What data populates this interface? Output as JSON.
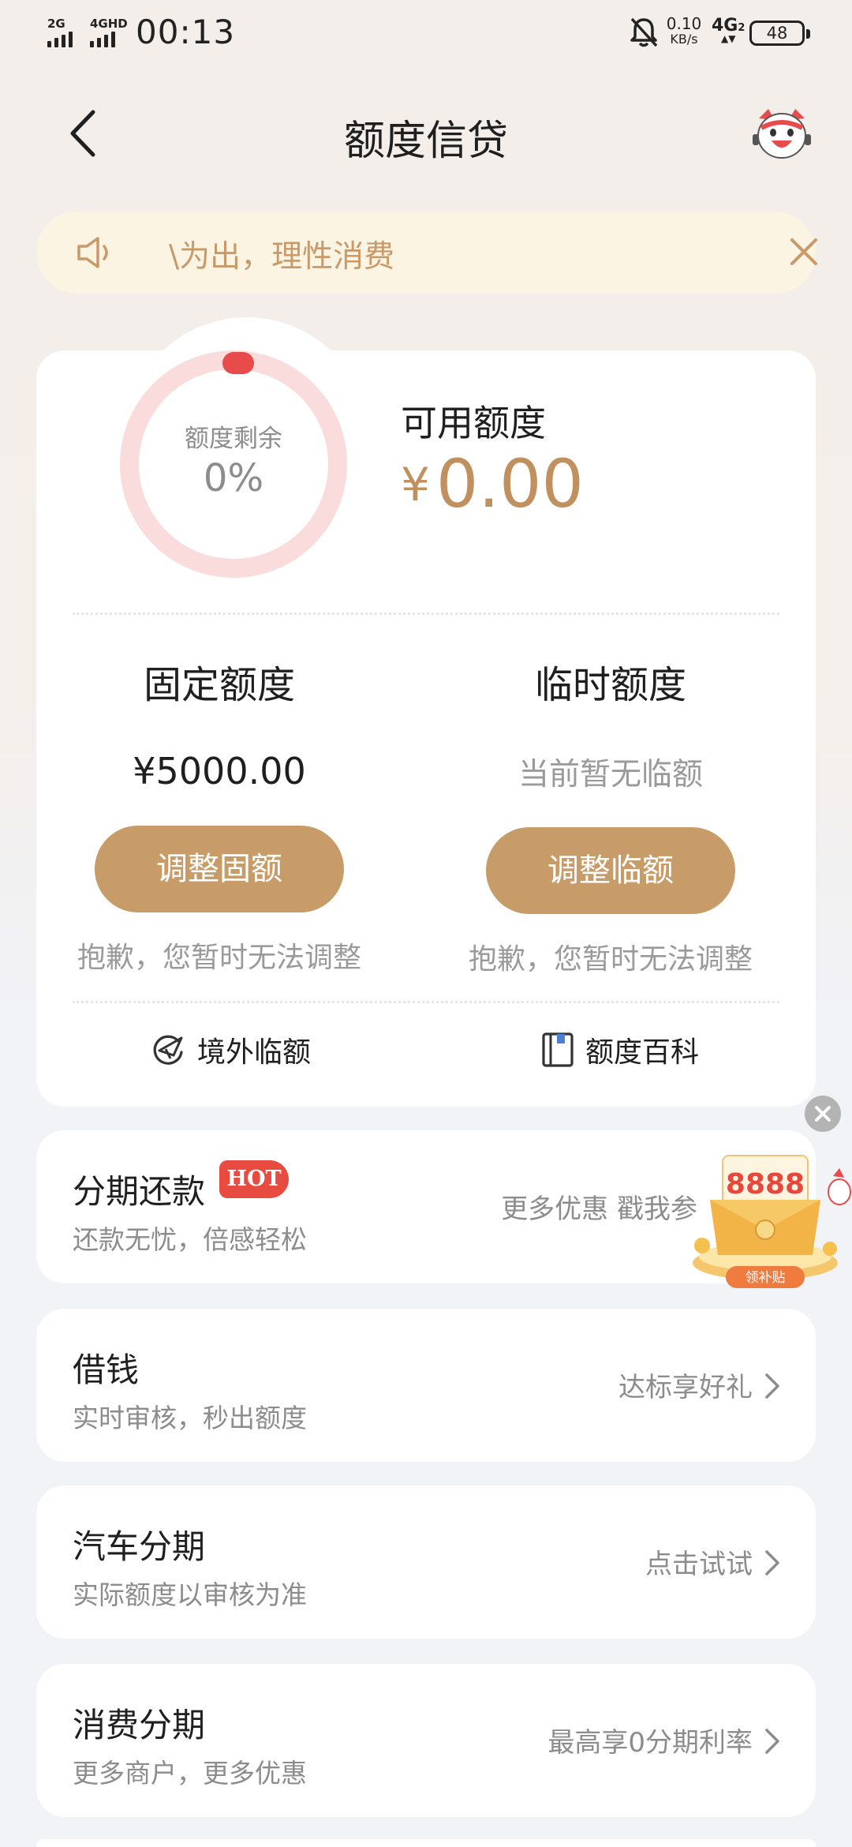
{
  "status_bar": {
    "signal1_label": "2G",
    "signal2_label": "4GHD",
    "time": "00:13",
    "speed_value": "0.10",
    "speed_unit": "KB/s",
    "network": "4G",
    "battery": "48",
    "icons": [
      "signal-icon",
      "bell-muted-icon",
      "battery-icon"
    ]
  },
  "nav": {
    "title": "额度信贷",
    "back_icon": "chevron-left-icon",
    "mascot_icon": "mascot-service-icon"
  },
  "notice": {
    "text": "\\为出，理性消费",
    "icon": "speaker-icon",
    "close_icon": "close-icon"
  },
  "credit": {
    "ring_label": "额度剩余",
    "ring_value": "0%",
    "remaining_fraction": 0,
    "available_label": "可用额度",
    "currency": "¥",
    "available_amount": "0.00",
    "fixed": {
      "title": "固定额度",
      "value": "¥5000.00",
      "button": "调整固额",
      "note": "抱歉，您暂时无法调整"
    },
    "temp": {
      "title": "临时额度",
      "value": "当前暂无临额",
      "button": "调整临额",
      "note": "抱歉，您暂时无法调整"
    },
    "links": [
      {
        "label": "境外临额",
        "icon": "plane-globe-icon"
      },
      {
        "label": "额度百科",
        "icon": "book-icon"
      }
    ]
  },
  "services": [
    {
      "title": "分期还款",
      "badge": "HOT",
      "subtitle": "还款无忧，倍感轻松",
      "right": "更多优惠 戳我参"
    },
    {
      "title": "借钱",
      "subtitle": "实时审核，秒出额度",
      "right": "达标享好礼"
    },
    {
      "title": "汽车分期",
      "subtitle": "实际额度以审核为准",
      "right": "点击试试"
    },
    {
      "title": "消费分期",
      "subtitle": "更多商户，更多优惠",
      "right": "最高享0分期利率"
    }
  ],
  "promo": {
    "amount": "8888",
    "label": "领补贴",
    "icon": "gift-envelope-icon"
  },
  "colors": {
    "accent": "#c89c68",
    "ring_track": "#fbdcdc",
    "ring_marker": "#e84b4b",
    "hot": "#e84b3f",
    "notice_bg": "#fcf4e2"
  }
}
